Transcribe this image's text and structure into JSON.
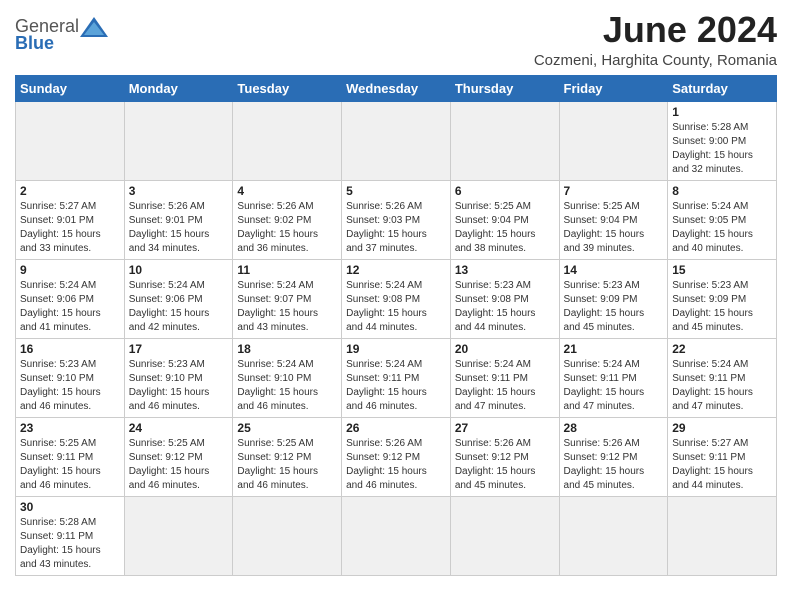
{
  "header": {
    "logo_general": "General",
    "logo_blue": "Blue",
    "title": "June 2024",
    "subtitle": "Cozmeni, Harghita County, Romania"
  },
  "weekdays": [
    "Sunday",
    "Monday",
    "Tuesday",
    "Wednesday",
    "Thursday",
    "Friday",
    "Saturday"
  ],
  "weeks": [
    [
      {
        "day": "",
        "info": "",
        "empty": true
      },
      {
        "day": "",
        "info": "",
        "empty": true
      },
      {
        "day": "",
        "info": "",
        "empty": true
      },
      {
        "day": "",
        "info": "",
        "empty": true
      },
      {
        "day": "",
        "info": "",
        "empty": true
      },
      {
        "day": "",
        "info": "",
        "empty": true
      },
      {
        "day": "1",
        "info": "Sunrise: 5:28 AM\nSunset: 9:00 PM\nDaylight: 15 hours\nand 32 minutes."
      }
    ],
    [
      {
        "day": "2",
        "info": "Sunrise: 5:27 AM\nSunset: 9:01 PM\nDaylight: 15 hours\nand 33 minutes."
      },
      {
        "day": "3",
        "info": "Sunrise: 5:26 AM\nSunset: 9:01 PM\nDaylight: 15 hours\nand 34 minutes."
      },
      {
        "day": "4",
        "info": "Sunrise: 5:26 AM\nSunset: 9:02 PM\nDaylight: 15 hours\nand 36 minutes."
      },
      {
        "day": "5",
        "info": "Sunrise: 5:26 AM\nSunset: 9:03 PM\nDaylight: 15 hours\nand 37 minutes."
      },
      {
        "day": "6",
        "info": "Sunrise: 5:25 AM\nSunset: 9:04 PM\nDaylight: 15 hours\nand 38 minutes."
      },
      {
        "day": "7",
        "info": "Sunrise: 5:25 AM\nSunset: 9:04 PM\nDaylight: 15 hours\nand 39 minutes."
      },
      {
        "day": "8",
        "info": "Sunrise: 5:24 AM\nSunset: 9:05 PM\nDaylight: 15 hours\nand 40 minutes."
      }
    ],
    [
      {
        "day": "9",
        "info": "Sunrise: 5:24 AM\nSunset: 9:06 PM\nDaylight: 15 hours\nand 41 minutes."
      },
      {
        "day": "10",
        "info": "Sunrise: 5:24 AM\nSunset: 9:06 PM\nDaylight: 15 hours\nand 42 minutes."
      },
      {
        "day": "11",
        "info": "Sunrise: 5:24 AM\nSunset: 9:07 PM\nDaylight: 15 hours\nand 43 minutes."
      },
      {
        "day": "12",
        "info": "Sunrise: 5:24 AM\nSunset: 9:08 PM\nDaylight: 15 hours\nand 44 minutes."
      },
      {
        "day": "13",
        "info": "Sunrise: 5:23 AM\nSunset: 9:08 PM\nDaylight: 15 hours\nand 44 minutes."
      },
      {
        "day": "14",
        "info": "Sunrise: 5:23 AM\nSunset: 9:09 PM\nDaylight: 15 hours\nand 45 minutes."
      },
      {
        "day": "15",
        "info": "Sunrise: 5:23 AM\nSunset: 9:09 PM\nDaylight: 15 hours\nand 45 minutes."
      }
    ],
    [
      {
        "day": "16",
        "info": "Sunrise: 5:23 AM\nSunset: 9:10 PM\nDaylight: 15 hours\nand 46 minutes."
      },
      {
        "day": "17",
        "info": "Sunrise: 5:23 AM\nSunset: 9:10 PM\nDaylight: 15 hours\nand 46 minutes."
      },
      {
        "day": "18",
        "info": "Sunrise: 5:24 AM\nSunset: 9:10 PM\nDaylight: 15 hours\nand 46 minutes."
      },
      {
        "day": "19",
        "info": "Sunrise: 5:24 AM\nSunset: 9:11 PM\nDaylight: 15 hours\nand 46 minutes."
      },
      {
        "day": "20",
        "info": "Sunrise: 5:24 AM\nSunset: 9:11 PM\nDaylight: 15 hours\nand 47 minutes."
      },
      {
        "day": "21",
        "info": "Sunrise: 5:24 AM\nSunset: 9:11 PM\nDaylight: 15 hours\nand 47 minutes."
      },
      {
        "day": "22",
        "info": "Sunrise: 5:24 AM\nSunset: 9:11 PM\nDaylight: 15 hours\nand 47 minutes."
      }
    ],
    [
      {
        "day": "23",
        "info": "Sunrise: 5:25 AM\nSunset: 9:11 PM\nDaylight: 15 hours\nand 46 minutes."
      },
      {
        "day": "24",
        "info": "Sunrise: 5:25 AM\nSunset: 9:12 PM\nDaylight: 15 hours\nand 46 minutes."
      },
      {
        "day": "25",
        "info": "Sunrise: 5:25 AM\nSunset: 9:12 PM\nDaylight: 15 hours\nand 46 minutes."
      },
      {
        "day": "26",
        "info": "Sunrise: 5:26 AM\nSunset: 9:12 PM\nDaylight: 15 hours\nand 46 minutes."
      },
      {
        "day": "27",
        "info": "Sunrise: 5:26 AM\nSunset: 9:12 PM\nDaylight: 15 hours\nand 45 minutes."
      },
      {
        "day": "28",
        "info": "Sunrise: 5:26 AM\nSunset: 9:12 PM\nDaylight: 15 hours\nand 45 minutes."
      },
      {
        "day": "29",
        "info": "Sunrise: 5:27 AM\nSunset: 9:11 PM\nDaylight: 15 hours\nand 44 minutes."
      }
    ],
    [
      {
        "day": "30",
        "info": "Sunrise: 5:28 AM\nSunset: 9:11 PM\nDaylight: 15 hours\nand 43 minutes."
      },
      {
        "day": "",
        "info": "",
        "empty": true
      },
      {
        "day": "",
        "info": "",
        "empty": true
      },
      {
        "day": "",
        "info": "",
        "empty": true
      },
      {
        "day": "",
        "info": "",
        "empty": true
      },
      {
        "day": "",
        "info": "",
        "empty": true
      },
      {
        "day": "",
        "info": "",
        "empty": true
      }
    ]
  ]
}
